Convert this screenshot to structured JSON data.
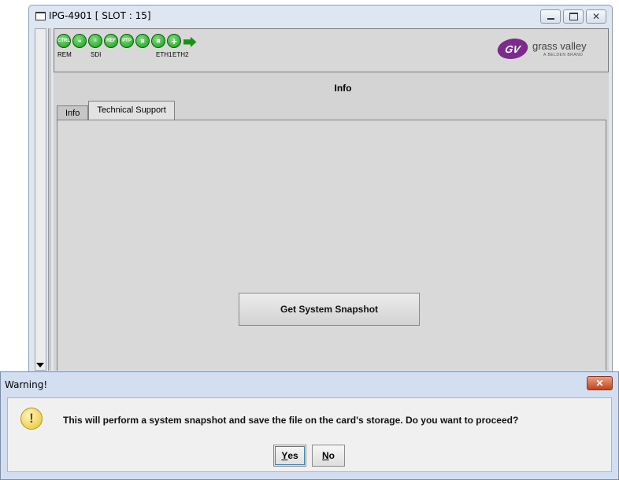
{
  "window": {
    "title": "IPG-4901 [ SLOT : 15]",
    "controls": [
      "minimize-icon",
      "maximize-icon",
      "close-icon"
    ]
  },
  "toolbar": {
    "status_icons": [
      {
        "name": "ctrl-icon",
        "text": "CTRL",
        "color": "#1ea01e"
      },
      {
        "name": "link-icon",
        "text": "",
        "color": "#1ea01e"
      },
      {
        "name": "sdi-icon",
        "text": "",
        "color": "#1ea01e"
      },
      {
        "name": "ref-icon",
        "text": "REF",
        "color": "#1ea01e"
      },
      {
        "name": "ptp-icon",
        "text": "PTP",
        "color": "#1ea01e"
      },
      {
        "name": "eth1-icon",
        "text": "",
        "color": "#1ea01e"
      },
      {
        "name": "eth2-icon",
        "text": "",
        "color": "#1ea01e"
      },
      {
        "name": "plus-icon",
        "text": "",
        "color": "#1ea01e"
      },
      {
        "name": "export-icon",
        "text": "",
        "color": "#1ea01e"
      }
    ],
    "labels": {
      "rem": "REM",
      "sdi": "SDI",
      "eth1": "ETH1",
      "eth2": "ETH2"
    },
    "logo": {
      "brand": "grass valley",
      "sub": "A BELDEN BRAND",
      "color": "#7b2b8b"
    }
  },
  "panel": {
    "title": "Info",
    "tabs": [
      {
        "label": "Info",
        "active": false
      },
      {
        "label": "Technical Support",
        "active": true
      }
    ],
    "snapshot_button": "Get System Snapshot"
  },
  "dialog": {
    "title": "Warning!",
    "message": "This will perform a system snapshot and save the file on the card's storage. Do you want to proceed?",
    "yes": {
      "mnemonic": "Y",
      "rest": "es"
    },
    "no": {
      "mnemonic": "N",
      "rest": "o"
    }
  },
  "colors": {
    "status_green": "#1ea01e",
    "dialog_close": "#c2431b",
    "warning": "#e7c028"
  }
}
